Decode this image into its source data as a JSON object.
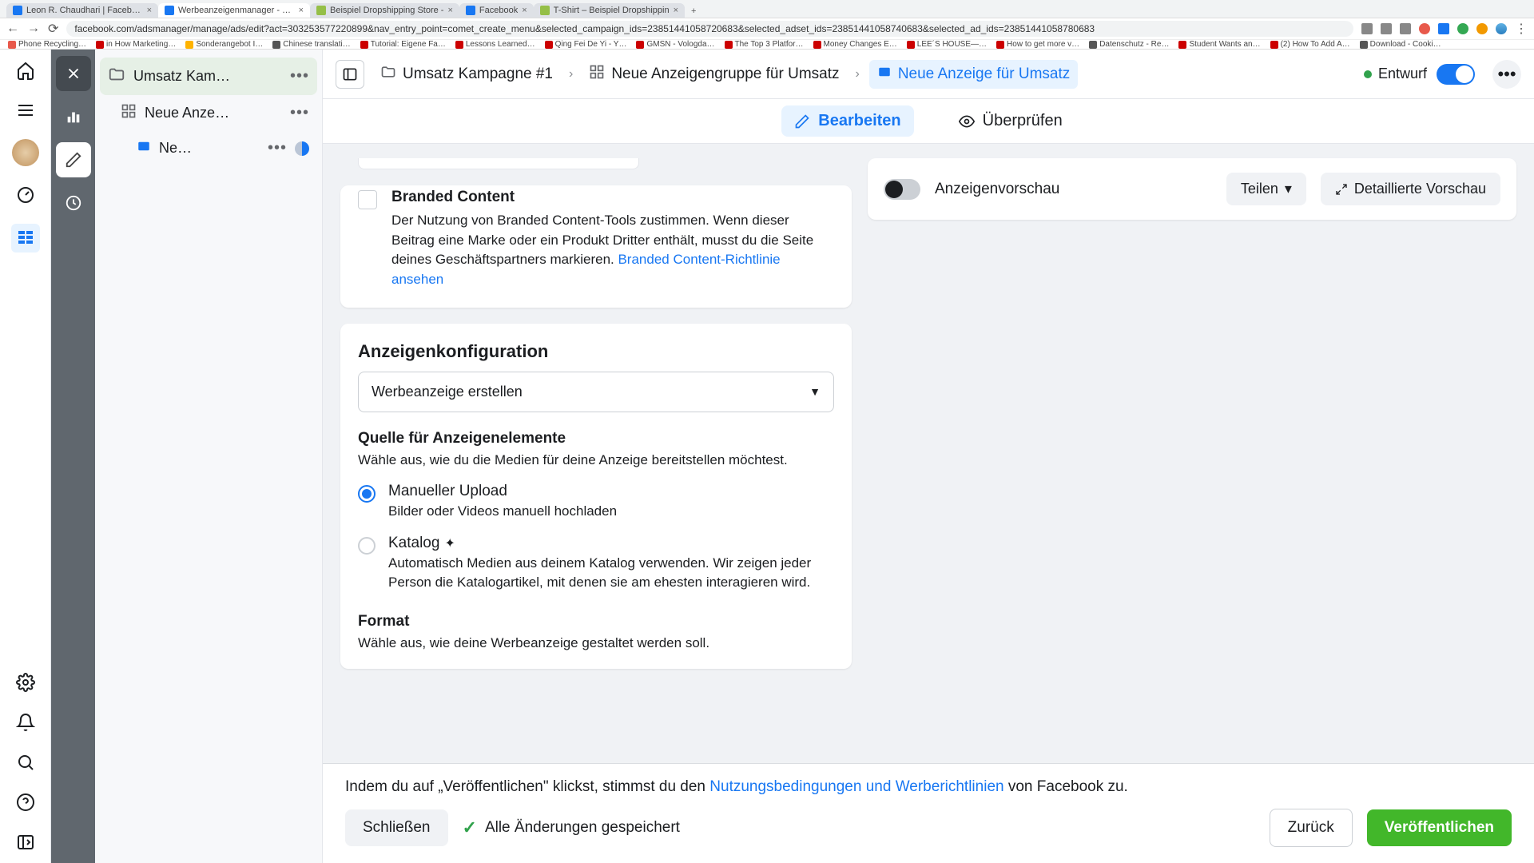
{
  "browser": {
    "tabs": [
      {
        "title": "Leon R. Chaudhari | Facebook",
        "favicon": "#1877f2"
      },
      {
        "title": "Werbeanzeigenmanager - We",
        "favicon": "#1877f2",
        "active": true
      },
      {
        "title": "Beispiel Dropshipping Store -",
        "favicon": "#95bf47"
      },
      {
        "title": "Facebook",
        "favicon": "#1877f2"
      },
      {
        "title": "T-Shirt – Beispiel Dropshippin",
        "favicon": "#95bf47"
      }
    ],
    "url": "facebook.com/adsmanager/manage/ads/edit?act=303253577220899&nav_entry_point=comet_create_menu&selected_campaign_ids=23851441058720683&selected_adset_ids=23851441058740683&selected_ad_ids=23851441058780683",
    "bookmarks": [
      {
        "label": "Phone Recycling…",
        "color": "#e8594b"
      },
      {
        "label": "in How Marketing…",
        "color": "#cc0000"
      },
      {
        "label": "Sonderangebot I…",
        "color": "#ffb300"
      },
      {
        "label": "Chinese translati…",
        "color": "#555"
      },
      {
        "label": "Tutorial: Eigene Fa…",
        "color": "#cc0000"
      },
      {
        "label": "Lessons Learned…",
        "color": "#cc0000"
      },
      {
        "label": "Qing Fei De Yi - Y…",
        "color": "#cc0000"
      },
      {
        "label": "GMSN - Vologda…",
        "color": "#cc0000"
      },
      {
        "label": "The Top 3 Platfor…",
        "color": "#cc0000"
      },
      {
        "label": "Money Changes E…",
        "color": "#cc0000"
      },
      {
        "label": "LEE´S HOUSE—…",
        "color": "#cc0000"
      },
      {
        "label": "How to get more v…",
        "color": "#cc0000"
      },
      {
        "label": "Datenschutz - Re…",
        "color": "#555"
      },
      {
        "label": "Student Wants an…",
        "color": "#cc0000"
      },
      {
        "label": "(2) How To Add A…",
        "color": "#cc0000"
      },
      {
        "label": "Download - Cooki…",
        "color": "#555"
      }
    ]
  },
  "tree": {
    "campaign": "Umsatz Kam…",
    "adset": "Neue Anze…",
    "ad": "Ne…"
  },
  "breadcrumb": {
    "campaign": "Umsatz Kampagne #1",
    "adset": "Neue Anzeigengruppe für Umsatz",
    "ad": "Neue Anzeige für Umsatz",
    "status": "Entwurf"
  },
  "tabs": {
    "edit": "Bearbeiten",
    "review": "Überprüfen"
  },
  "branded": {
    "title": "Branded Content",
    "desc": "Der Nutzung von Branded Content-Tools zustimmen. Wenn dieser Beitrag eine Marke oder ein Produkt Dritter enthält, musst du die Seite deines Geschäftspartners markieren. ",
    "link": "Branded Content-Richtlinie ansehen"
  },
  "config": {
    "title": "Anzeigenkonfiguration",
    "select": "Werbeanzeige erstellen",
    "source_head": "Quelle für Anzeigenelemente",
    "source_desc": "Wähle aus, wie du die Medien für deine Anzeige bereitstellen möchtest.",
    "manual_title": "Manueller Upload",
    "manual_desc": "Bilder oder Videos manuell hochladen",
    "catalog_title": "Katalog",
    "catalog_desc": "Automatisch Medien aus deinem Katalog verwenden. Wir zeigen jeder Person die Katalogartikel, mit denen sie am ehesten interagieren wird.",
    "format_head": "Format",
    "format_desc": "Wähle aus, wie deine Werbeanzeige gestaltet werden soll."
  },
  "preview": {
    "title": "Anzeigenvorschau",
    "share": "Teilen",
    "detail": "Detaillierte Vorschau"
  },
  "footer": {
    "agree_pre": "Indem du auf „Veröffentlichen\" klickst, stimmst du den ",
    "agree_link": "Nutzungsbedingungen und Werberichtlinien",
    "agree_post": " von Facebook zu.",
    "close": "Schließen",
    "saved": "Alle Änderungen gespeichert",
    "back": "Zurück",
    "publish": "Veröffentlichen"
  }
}
